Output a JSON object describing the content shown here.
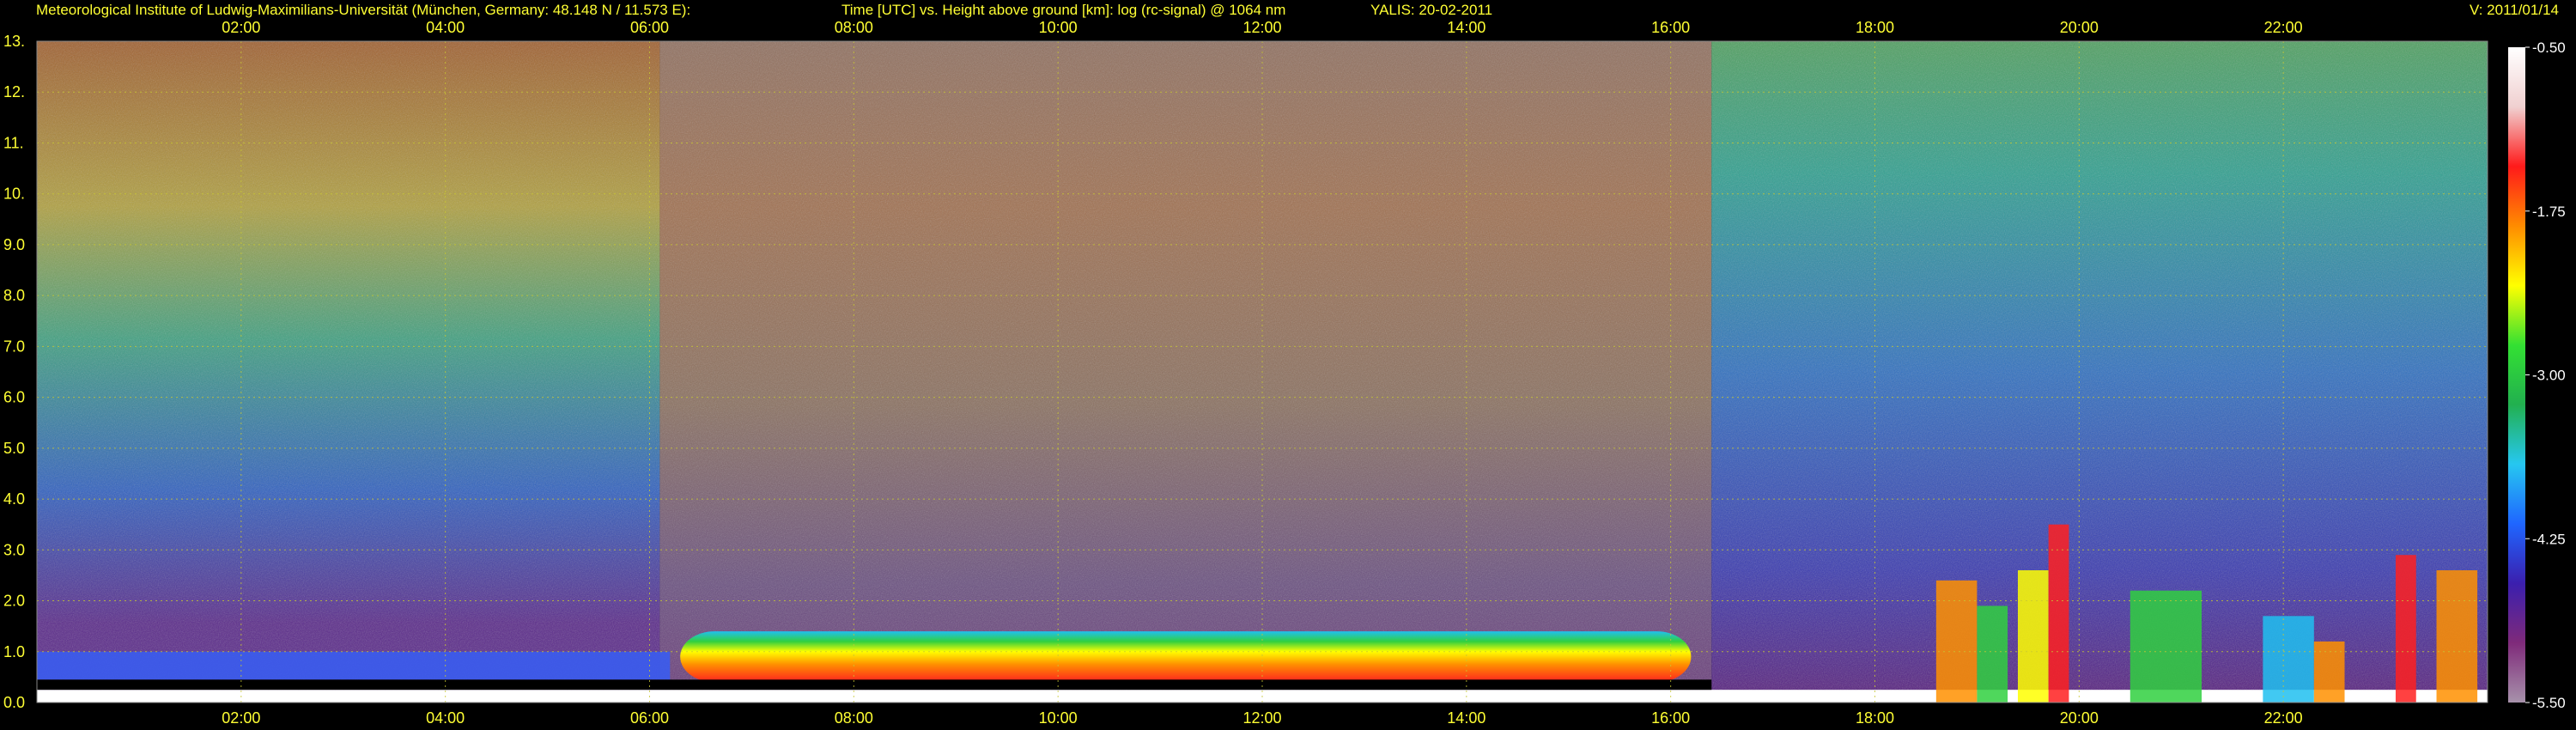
{
  "header": {
    "institute": "Meteorological Institute of Ludwig-Maximilians-Universität (München, Germany: 48.148 N / 11.573 E):",
    "axes_title": "Time [UTC] vs. Height above ground [km]: log (rc-signal) @ 1064 nm",
    "instrument": "YALIS: 20-02-2011",
    "version": "V: 2011/01/14"
  },
  "colors": {
    "background": "#000000",
    "text": "#ffff33",
    "grid": "#c8c832",
    "colorbar_label": "#ffffff",
    "colormap": [
      "#a792ab",
      "#7f2a7a",
      "#3b1fae",
      "#1f66ff",
      "#26c7f0",
      "#22b04f",
      "#33e033",
      "#ffff00",
      "#ff8c00",
      "#ff1a1a",
      "#f0d0d0",
      "#ffffff"
    ]
  },
  "chart_data": {
    "type": "heatmap",
    "title": "Time [UTC] vs. Height above ground [km]: log (rc-signal) @ 1064 nm",
    "xlabel": "Time [UTC]",
    "ylabel": "Height above ground [km]",
    "x_range_hours": [
      0.0,
      24.0
    ],
    "x_ticks": [
      "02:00",
      "04:00",
      "06:00",
      "08:00",
      "10:00",
      "12:00",
      "14:00",
      "16:00",
      "18:00",
      "20:00",
      "22:00"
    ],
    "x_tick_hours": [
      2,
      4,
      6,
      8,
      10,
      12,
      14,
      16,
      18,
      20,
      22
    ],
    "y_range_km": [
      0.0,
      13.0
    ],
    "y_ticks": [
      "0.0",
      "1.0",
      "2.0",
      "3.0",
      "4.0",
      "5.0",
      "6.0",
      "7.0",
      "8.0",
      "9.0",
      "10.",
      "11.",
      "12.",
      "13."
    ],
    "y_tick_values": [
      0,
      1,
      2,
      3,
      4,
      5,
      6,
      7,
      8,
      9,
      10,
      11,
      12,
      13
    ],
    "grid": true,
    "colorbar": {
      "range": [
        -5.5,
        -0.5
      ],
      "ticks": [
        "-0.50",
        "-1.75",
        "-3.00",
        "-4.25",
        "-5.50"
      ],
      "tick_values": [
        -0.5,
        -1.75,
        -3.0,
        -4.25,
        -5.5
      ]
    }
  }
}
